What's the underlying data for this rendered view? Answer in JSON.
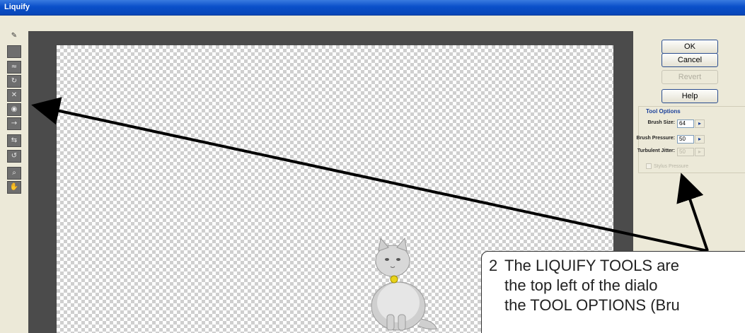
{
  "window": {
    "title": "Liquify"
  },
  "buttons": {
    "ok": "OK",
    "cancel": "Cancel",
    "revert": "Revert",
    "help": "Help"
  },
  "tool_options": {
    "title": "Tool Options",
    "brush_size_label": "Brush Size:",
    "brush_size_value": "64",
    "brush_pressure_label": "Brush Pressure:",
    "brush_pressure_value": "50",
    "turbulent_jitter_label": "Turbulent Jitter:",
    "turbulent_jitter_value": "50",
    "stylus_pressure_label": "Stylus Pressure"
  },
  "callout": {
    "number": "2",
    "line1": "The LIQUIFY TOOLS are",
    "line2": "the top left of the dialo",
    "line3": "the TOOL OPTIONS (Bru"
  },
  "colors": {
    "titlebar": "#0a4fc9",
    "dialog_bg": "#ece9d8",
    "canvas_frame": "#4b4b4b",
    "group_title": "#1a3f9a"
  },
  "icons": [
    "warp-tool-icon",
    "turbulence-tool-icon",
    "twirl-clockwise-icon",
    "pucker-tool-icon",
    "bloat-tool-icon",
    "shift-pixels-icon",
    "reflection-tool-icon",
    "reconstruct-tool-icon",
    "zoom-tool-icon",
    "hand-tool-icon"
  ]
}
